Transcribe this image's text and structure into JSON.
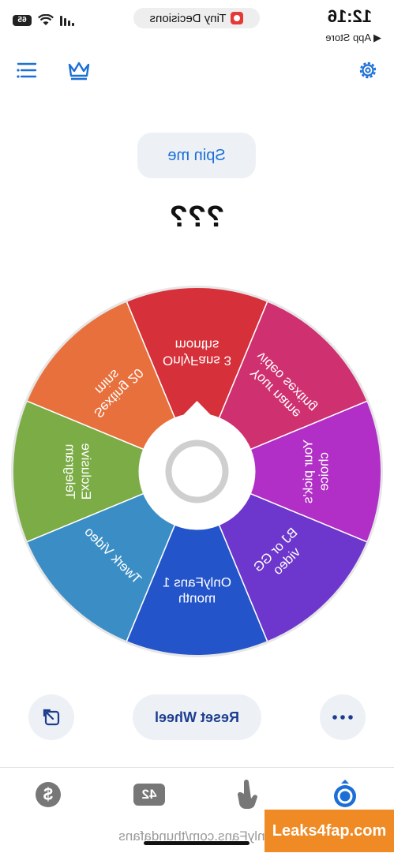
{
  "status_bar": {
    "time": "12:16",
    "back_label": "◀ App Store",
    "battery": "65"
  },
  "dynamic_island": {
    "app_name": "Tiny Decisions"
  },
  "toolbar": {
    "menu_icon": "list-icon",
    "crown_icon": "crown-icon",
    "settings_icon": "gear-icon",
    "accent": "#1c6fd6"
  },
  "spin_button": {
    "label": "Spin me"
  },
  "result": {
    "text": "???"
  },
  "wheel": {
    "segments": [
      {
        "lines": [
          "OnlyFans 3",
          "months"
        ],
        "color": "#d6303a"
      },
      {
        "lines": [
          "Sexting 20",
          "mins"
        ],
        "color": "#e8703d"
      },
      {
        "lines": [
          "Exclusive",
          "Telegram"
        ],
        "color": "#7bac45"
      },
      {
        "lines": [
          "Twerk Video"
        ],
        "color": "#3b8ec5"
      },
      {
        "lines": [
          "OnlyFans 1",
          "month"
        ],
        "color": "#2354c9"
      },
      {
        "lines": [
          "BJ or GG",
          "video"
        ],
        "color": "#6d36cc"
      },
      {
        "lines": [
          "Your pick's",
          "choice"
        ],
        "color": "#b12fc7"
      },
      {
        "lines": [
          "Your name",
          "video sexting"
        ],
        "color": "#cf3070"
      }
    ]
  },
  "bottom_actions": {
    "reset_label": "Reset Wheel",
    "share_icon": "share-icon",
    "more_icon": "more-icon"
  },
  "tab_bar": {
    "tabs": [
      {
        "icon": "spinner-icon",
        "active": true
      },
      {
        "icon": "hand-icon",
        "active": false
      },
      {
        "icon": "number-icon",
        "label": "42",
        "active": false
      },
      {
        "icon": "coin-icon",
        "label": "$",
        "active": false
      }
    ]
  },
  "footer_watermark": "OnlyFans.com/thundafans",
  "site_watermark": "Leaks4fap.com"
}
